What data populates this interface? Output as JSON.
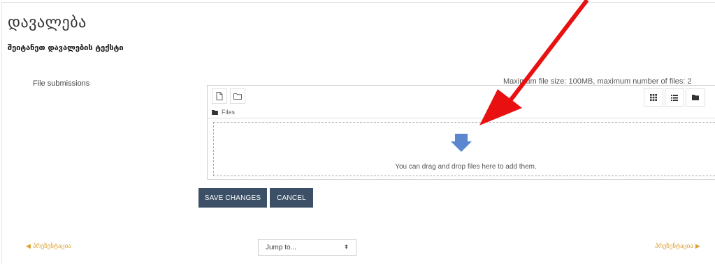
{
  "page": {
    "title": "დავალება",
    "subtitle": "შეიტანეთ დავალების ტექსტი"
  },
  "submission": {
    "field_label": "File submissions",
    "limits": "Maximum file size: 100MB, maximum number of files: 2",
    "path_label": "Files",
    "drop_text": "You can drag and drop files here to add them.",
    "toolbar_icons": [
      "add-file-icon",
      "create-folder-icon"
    ],
    "view_icons": [
      "grid-view-icon",
      "list-view-icon",
      "folder-view-icon"
    ]
  },
  "buttons": {
    "save": "SAVE CHANGES",
    "cancel": "CANCEL"
  },
  "navigation": {
    "prev_label": "პრეზენტაცია",
    "next_label": "პრეზენტაცია",
    "jump_placeholder": "Jump to..."
  },
  "colors": {
    "button_bg": "#3b4f66",
    "nav_link": "#e0a030",
    "annotation_arrow": "#e81010",
    "drop_arrow": "#5a87cf"
  }
}
